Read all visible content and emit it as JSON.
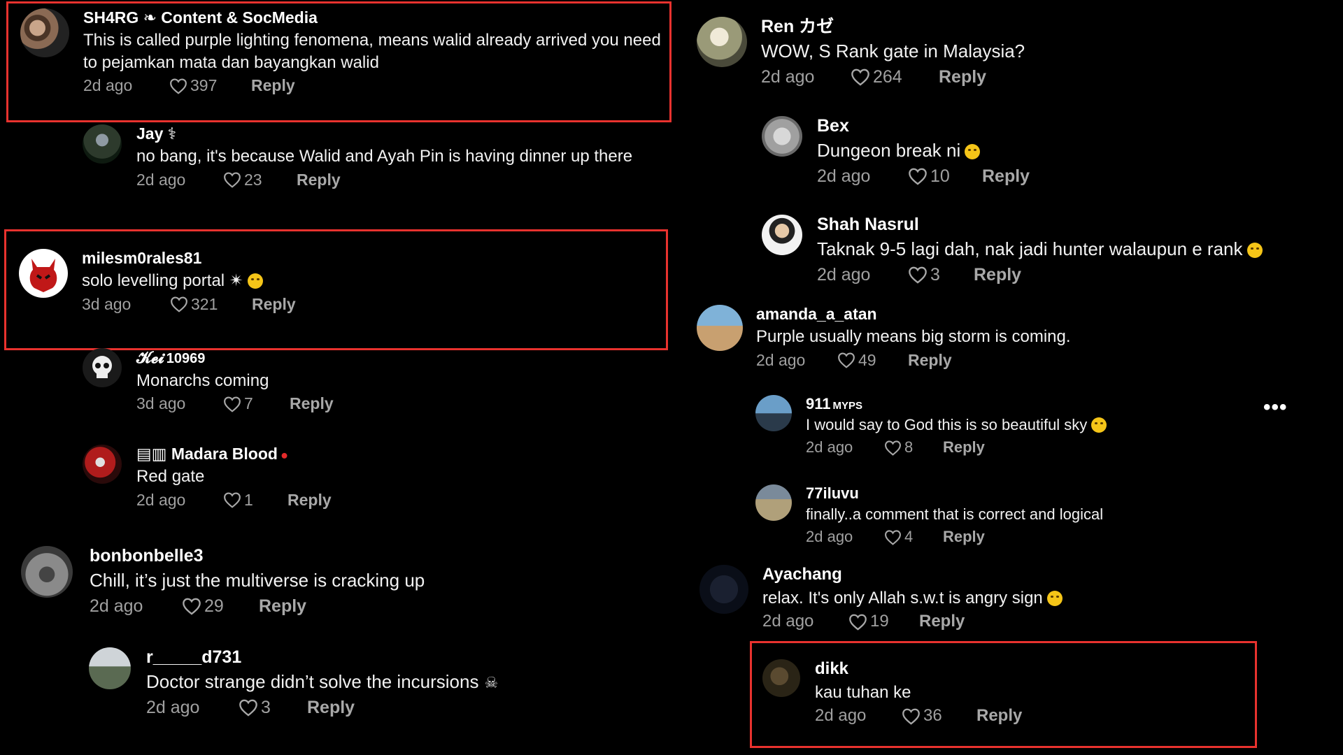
{
  "comments": {
    "c1": {
      "user": "SH4RG ❧ Content & SocMedia",
      "text": "This is called purple lighting fenomena, means walid already arrived you need to pejamkan mata dan bayangkan walid",
      "time": "2d ago",
      "likes": "397",
      "reply": "Reply"
    },
    "c2": {
      "user": "Jay ⚕",
      "text": "no bang, it's because Walid and Ayah Pin is having dinner up there",
      "time": "2d ago",
      "likes": "23",
      "reply": "Reply"
    },
    "c3": {
      "user": "milesm0rales81",
      "text": "solo levelling portal ✴",
      "time": "3d ago",
      "likes": "321",
      "reply": "Reply"
    },
    "c4": {
      "user": "𝓚𝓮𝓲",
      "tag": "10969",
      "text": "Monarchs coming",
      "time": "3d ago",
      "likes": "7",
      "reply": "Reply"
    },
    "c5": {
      "user": "▤▥ Madara Blood",
      "text": "Red gate",
      "time": "2d ago",
      "likes": "1",
      "reply": "Reply"
    },
    "c6": {
      "user": "bonbonbelle3",
      "text": "Chill, it’s just the multiverse is cracking up",
      "time": "2d ago",
      "likes": "29",
      "reply": "Reply"
    },
    "c7": {
      "user": "r_____d731",
      "text": "Doctor strange didn’t solve the incursions",
      "time": "2d ago",
      "likes": "3",
      "reply": "Reply"
    },
    "c8": {
      "user": "Ren カゼ",
      "text": "WOW, S Rank gate in Malaysia?",
      "time": "2d ago",
      "likes": "264",
      "reply": "Reply"
    },
    "c9": {
      "user": "Bex",
      "text": "Dungeon break ni",
      "time": "2d ago",
      "likes": "10",
      "reply": "Reply"
    },
    "c10": {
      "user": "Shah Nasrul",
      "text": "Taknak 9-5 lagi dah, nak jadi hunter walaupun e rank",
      "time": "2d ago",
      "likes": "3",
      "reply": "Reply"
    },
    "c11": {
      "user": "amanda_a_atan",
      "text": "Purple usually means big storm is coming.",
      "time": "2d ago",
      "likes": "49",
      "reply": "Reply"
    },
    "c12": {
      "user": "911",
      "tag": "MYPS",
      "text": "I would say to God this is so beautiful sky",
      "time": "2d ago",
      "likes": "8",
      "reply": "Reply"
    },
    "c13": {
      "user": "77iluvu",
      "text": "finally..a comment that is correct and logical",
      "time": "2d ago",
      "likes": "4",
      "reply": "Reply"
    },
    "c14": {
      "user": "Ayachang",
      "text": "relax. It's only Allah s.w.t is angry sign",
      "time": "2d ago",
      "likes": "19",
      "reply": "Reply"
    },
    "c15": {
      "user": "dikk",
      "text": "kau tuhan ke",
      "time": "2d ago",
      "likes": "36",
      "reply": "Reply"
    }
  },
  "more_label": "•••",
  "colors": {
    "background": "#000000",
    "highlight": "#e8322e",
    "meta": "#a0a0a0"
  },
  "icons": {
    "like": "heart-outline-icon",
    "more": "more-options-icon"
  }
}
